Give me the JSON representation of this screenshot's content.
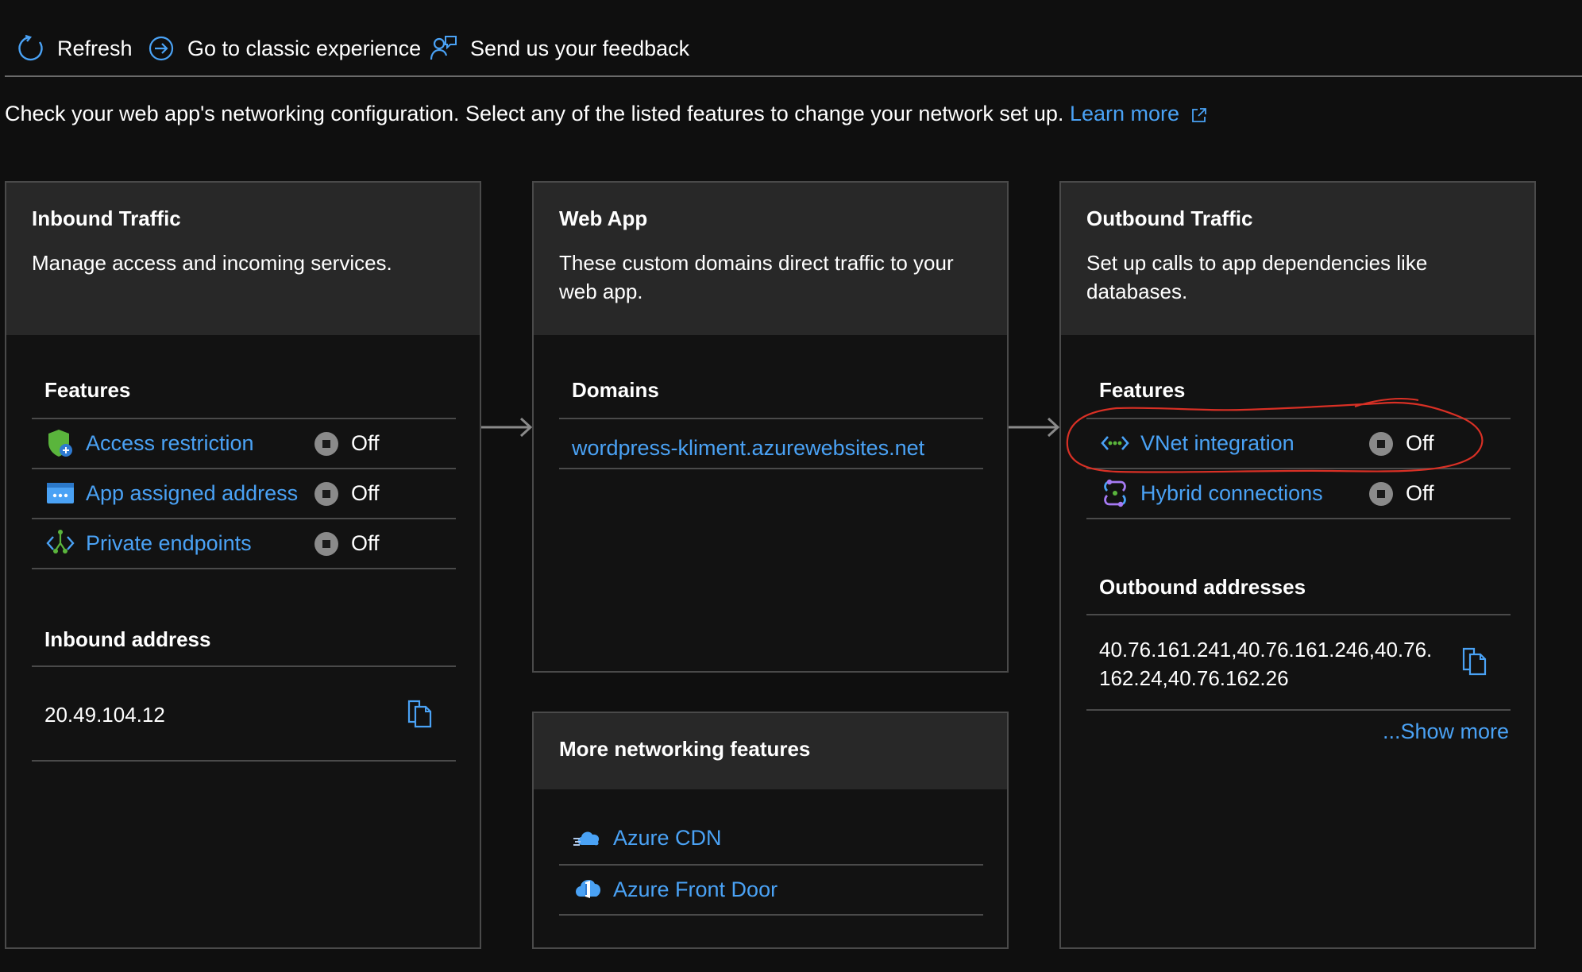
{
  "toolbar": {
    "refresh": "Refresh",
    "classic": "Go to classic experience",
    "feedback": "Send us your feedback"
  },
  "intro": {
    "text": "Check your web app's networking configuration. Select any of the listed features to change your network set up.",
    "learn_more": "Learn more"
  },
  "inbound": {
    "title": "Inbound Traffic",
    "description": "Manage access and incoming services.",
    "features_title": "Features",
    "features": [
      {
        "label": "Access restriction",
        "status": "Off",
        "icon": "shield-icon"
      },
      {
        "label": "App assigned address",
        "status": "Off",
        "icon": "address-card-icon"
      },
      {
        "label": "Private endpoints",
        "status": "Off",
        "icon": "private-endpoint-icon"
      }
    ],
    "address_title": "Inbound address",
    "address": "20.49.104.12"
  },
  "webapp": {
    "title": "Web App",
    "description": "These custom domains direct traffic to your web app.",
    "domains_title": "Domains",
    "domain": "wordpress-kliment.azurewebsites.net"
  },
  "more": {
    "title": "More networking features",
    "items": [
      {
        "label": "Azure CDN",
        "icon": "cdn-cloud-icon"
      },
      {
        "label": "Azure Front Door",
        "icon": "front-door-icon"
      }
    ]
  },
  "outbound": {
    "title": "Outbound Traffic",
    "description": "Set up calls to app dependencies like databases.",
    "features_title": "Features",
    "features": [
      {
        "label": "VNet integration",
        "status": "Off",
        "icon": "vnet-icon"
      },
      {
        "label": "Hybrid connections",
        "status": "Off",
        "icon": "hybrid-connection-icon"
      }
    ],
    "addresses_title": "Outbound addresses",
    "addresses": "40.76.161.241,40.76.161.246,40.76.162.24,40.76.162.26",
    "show_more": "...Show more"
  },
  "colors": {
    "link": "#4aa2f5",
    "annotation": "#d93025",
    "card_header": "#282828"
  }
}
